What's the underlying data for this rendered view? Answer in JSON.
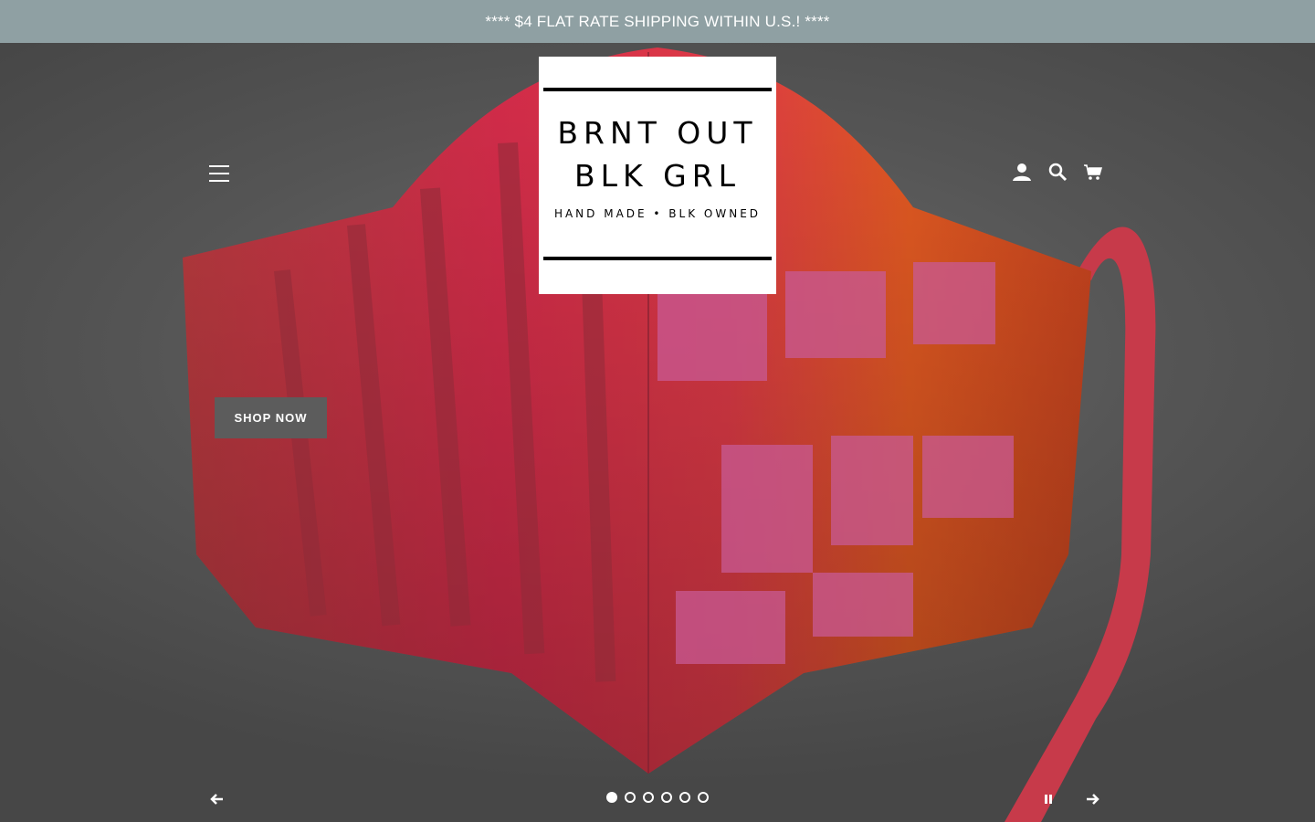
{
  "announcement": {
    "text": "**** $4 FLAT RATE SHIPPING WITHIN U.S.! ****"
  },
  "logo": {
    "line1": "BRNT OUT",
    "line2": "BLK GRL",
    "tagline": "HAND MADE • BLK OWNED"
  },
  "header": {
    "menu_icon": "hamburger-icon",
    "account_icon": "user-icon",
    "search_icon": "search-icon",
    "cart_icon": "cart-icon"
  },
  "hero": {
    "cta_label": "SHOP NOW",
    "slide_count": 6,
    "active_slide": 1,
    "image_description_colors": {
      "fabric_main": "#d8324e",
      "fabric_accent": "#e2571f",
      "fabric_stripe": "#a8344e",
      "backdrop": "#5a5a5a"
    }
  },
  "colors": {
    "announce_bg": "#8fa0a3",
    "cta_bg": "#5c5c5c"
  }
}
